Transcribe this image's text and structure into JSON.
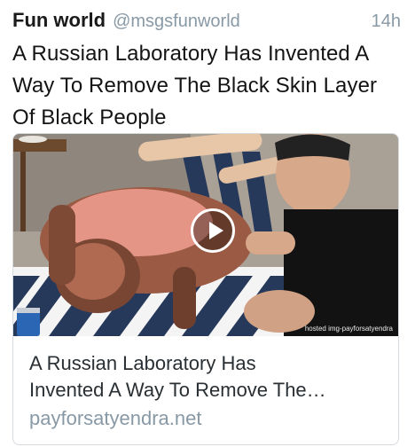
{
  "tweet": {
    "display_name": "Fun world",
    "handle": "@msgsfunworld",
    "time": "14h",
    "text": "A Russian Laboratory Has Invented A Way To Remove The Black Skin Layer Of Black People"
  },
  "card": {
    "title_line1": "A Russian Laboratory Has",
    "title_line2": "Invented A Way To Remove The…",
    "domain": "payforsatyendra.net",
    "watermark": "hosted img-payforsatyendra"
  },
  "icons": {
    "play": "play-icon"
  },
  "colors": {
    "name": "#1a1a1a",
    "muted": "#8899a6",
    "border": "#d6dbe0"
  }
}
